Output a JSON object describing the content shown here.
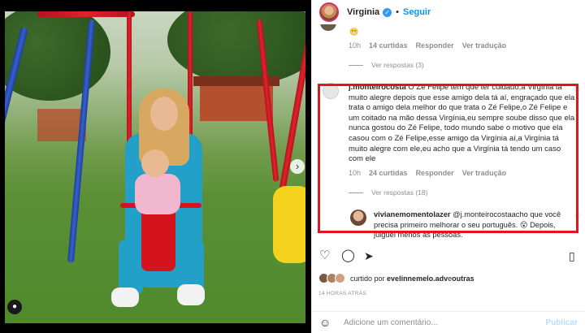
{
  "post": {
    "username": "Virginia",
    "follow_label": "Seguir",
    "separator": "•"
  },
  "comments": {
    "prev": {
      "time": "10h",
      "likes": "14 curtidas",
      "reply": "Responder",
      "translate": "Ver tradução",
      "view_replies": "Ver respostas (3)"
    },
    "main": {
      "username": "j.monteirocosta",
      "text": "O Zé Felipe tem que ter cuidado,a Virgínia tá muito alegre depois que esse amigo dela tá aí, engraçado que ela trata o amigo dela melhor do que trata o Zé Felipe,o Zé Felipe e um coitado na mão dessa Virgínia,eu sempre soube disso que ela nunca gostou do Zé Felipe, todo mundo sabe o motivo que ela casou com o Zé Felipe,esse amigo da Virgínia aí,a Virgínia tá muito alegre com ele,eu acho que a Virgínia tá tendo um caso com ele",
      "time": "10h",
      "likes": "24 curtidas",
      "reply": "Responder",
      "translate": "Ver tradução",
      "view_replies": "Ver respostas (18)"
    },
    "next": {
      "username": "vivianemomentolazer",
      "text": "@j.monteirocostaacho que você precisa primeiro melhorar o seu português. 😮 Depois, julguei menos as pessoas."
    }
  },
  "liked_by": {
    "prefix": "curtido por",
    "user": "evelinnemelo.adv",
    "and": "e",
    "others": "outras"
  },
  "time_ago": "14 HORAS ATRÁS",
  "add_comment": {
    "placeholder": "Adicione um comentário...",
    "publish": "Publicar"
  },
  "icons": {
    "emoji": "☺",
    "tag": "●",
    "nav_next": "›"
  },
  "colors": {
    "highlight": "#e3151a",
    "link": "#0095f6",
    "muted": "#8e8e8e"
  }
}
